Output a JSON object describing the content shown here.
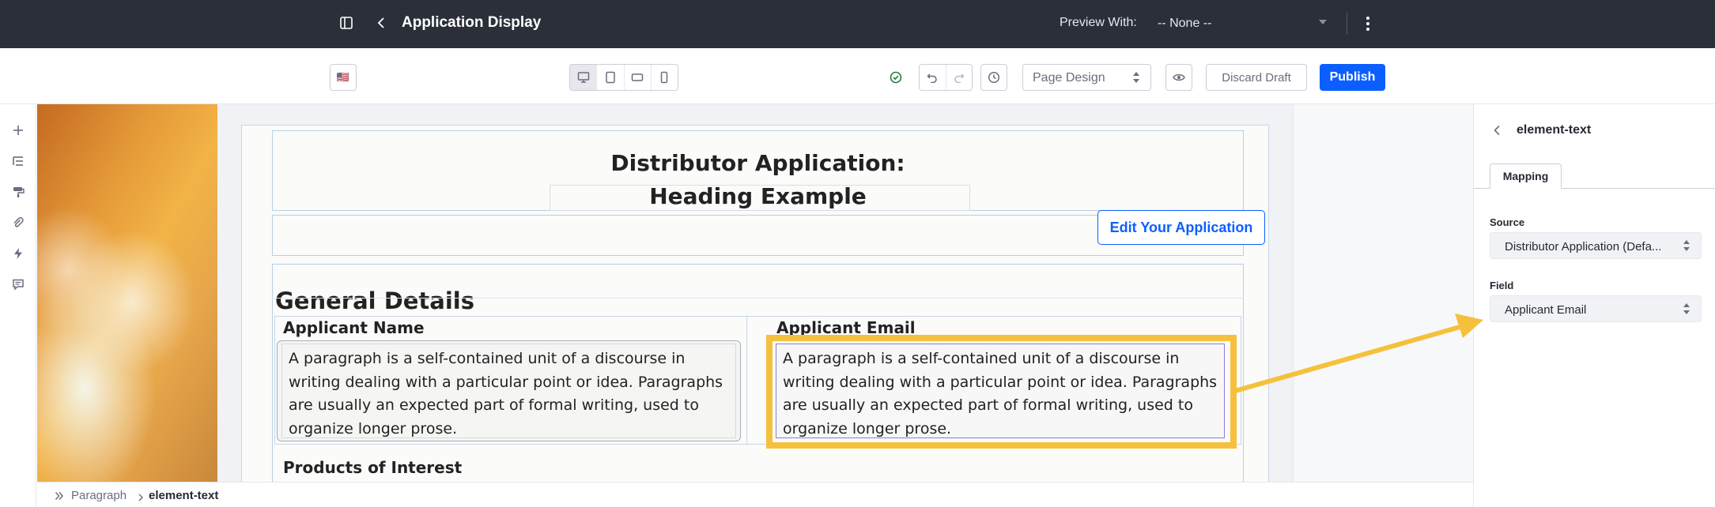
{
  "header": {
    "title": "Application Display",
    "preview_label": "Preview With:",
    "preview_value": "-- None --"
  },
  "toolbar": {
    "language_flag": "🇺🇸",
    "page_design_label": "Page Design",
    "discard_label": "Discard Draft",
    "publish_label": "Publish"
  },
  "page": {
    "heading_line1": "Distributor Application:",
    "heading_line2": "Heading Example",
    "edit_button": "Edit Your Application",
    "section_title": "General Details",
    "col1_label": "Applicant Name",
    "col2_label": "Applicant Email",
    "paragraph": "A paragraph is a self-contained unit of a discourse in writing dealing with a particular point or idea. Paragraphs are usually an expected part of formal writing, used to organize longer prose.",
    "products_label": "Products of Interest"
  },
  "panel": {
    "title": "element-text",
    "tab": "Mapping",
    "source_label": "Source",
    "source_value": "Distributor Application (Defa...",
    "field_label": "Field",
    "field_value": "Applicant Email"
  },
  "breadcrumb": {
    "item1": "Paragraph",
    "item2": "element-text"
  },
  "colors": {
    "topbar": "#2b2f3a",
    "primary": "#0b5fff",
    "highlight": "#f5c13c",
    "success": "#287d3c"
  }
}
